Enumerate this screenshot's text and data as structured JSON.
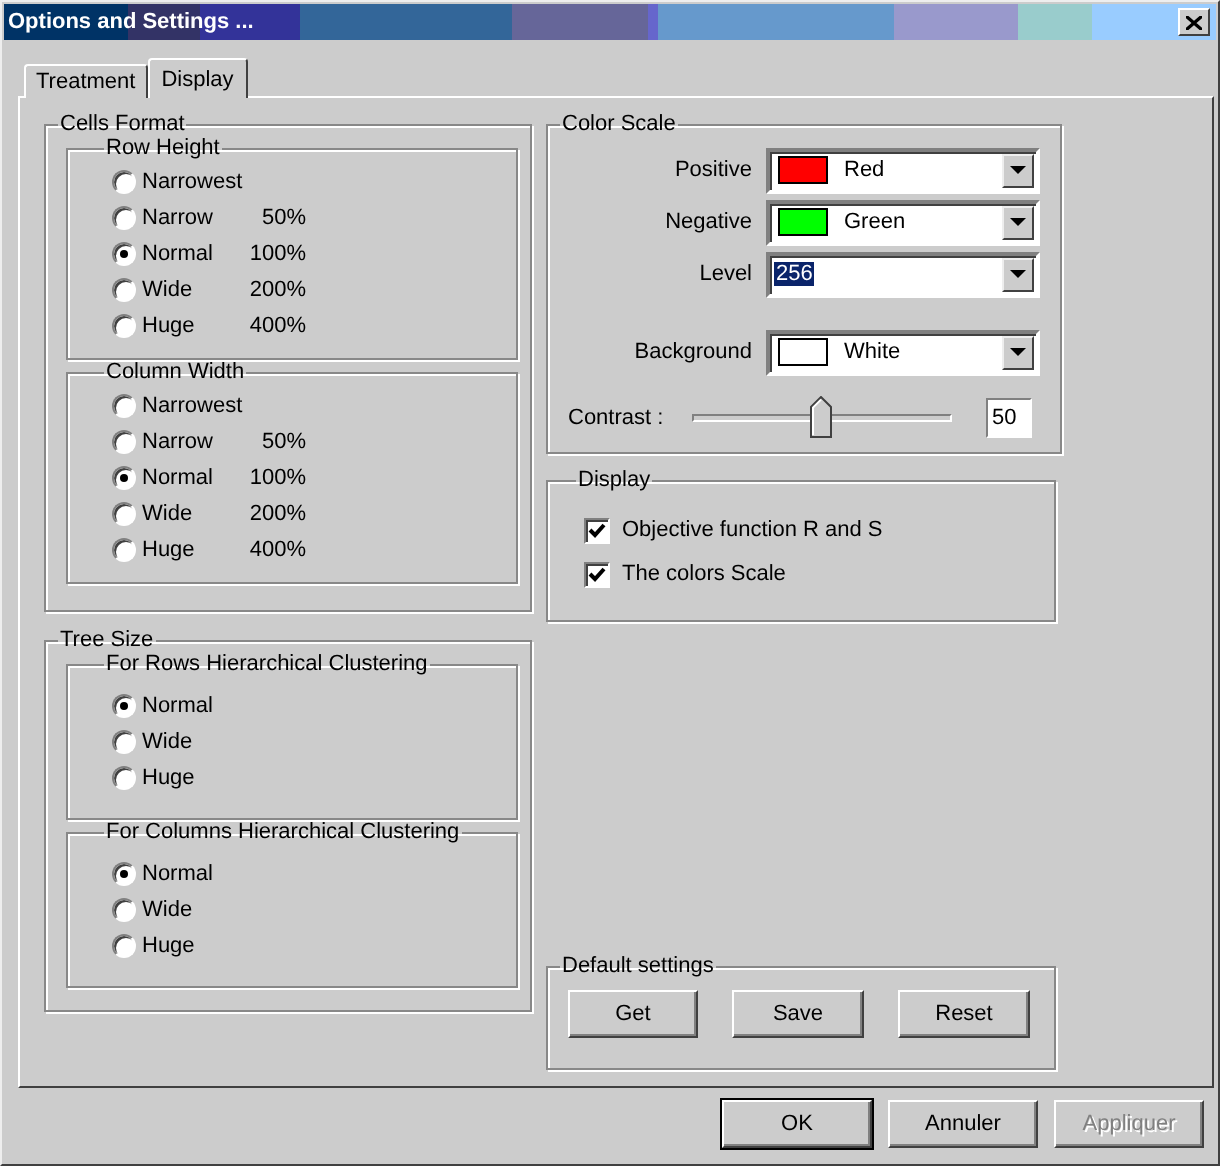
{
  "window": {
    "title": "Options and Settings ..."
  },
  "tabs": [
    {
      "label": "Treatment",
      "selected": false
    },
    {
      "label": "Display",
      "selected": true
    }
  ],
  "cells_format": {
    "title": "Cells Format",
    "groups": [
      {
        "title": "Row Height",
        "options": [
          {
            "label": "Narrowest",
            "selected": false
          },
          {
            "label": "Narrow",
            "value": "50%",
            "selected": false
          },
          {
            "label": "Normal",
            "value": "100%",
            "selected": true
          },
          {
            "label": "Wide",
            "value": "200%",
            "selected": false
          },
          {
            "label": "Huge",
            "value": "400%",
            "selected": false
          }
        ]
      },
      {
        "title": "Column Width",
        "options": [
          {
            "label": "Narrowest",
            "selected": false
          },
          {
            "label": "Narrow",
            "value": "50%",
            "selected": false
          },
          {
            "label": "Normal",
            "value": "100%",
            "selected": true
          },
          {
            "label": "Wide",
            "value": "200%",
            "selected": false
          },
          {
            "label": "Huge",
            "value": "400%",
            "selected": false
          }
        ]
      }
    ]
  },
  "tree_size": {
    "title": "Tree Size",
    "groups": [
      {
        "title": "For Rows Hierarchical Clustering",
        "options": [
          {
            "label": "Normal",
            "selected": true
          },
          {
            "label": "Wide",
            "selected": false
          },
          {
            "label": "Huge",
            "selected": false
          }
        ]
      },
      {
        "title": "For Columns Hierarchical Clustering",
        "options": [
          {
            "label": "Normal",
            "selected": true
          },
          {
            "label": "Wide",
            "selected": false
          },
          {
            "label": "Huge",
            "selected": false
          }
        ]
      }
    ]
  },
  "color_scale": {
    "title": "Color Scale",
    "rows": [
      {
        "label": "Positive",
        "value": "Red",
        "color": "#ff0000"
      },
      {
        "label": "Negative",
        "value": "Green",
        "color": "#00ff00"
      },
      {
        "label": "Level",
        "value": "256",
        "highlighted": true
      }
    ],
    "background": {
      "label": "Background",
      "value": "White",
      "color": "#ffffff"
    },
    "contrast": {
      "label": "Contrast :",
      "level": 0.5,
      "value": "50"
    }
  },
  "display": {
    "title": "Display",
    "options": [
      {
        "label": "Objective function R and S",
        "checked": true
      },
      {
        "label": "The colors Scale",
        "checked": true
      }
    ]
  },
  "default_settings": {
    "title": "Default settings",
    "buttons": [
      "Get",
      "Save",
      "Reset"
    ]
  },
  "buttons": [
    {
      "label": "OK",
      "default": true,
      "disabled": false
    },
    {
      "label": "Annuler",
      "default": false,
      "disabled": false
    },
    {
      "label": "Appliquer",
      "default": false,
      "disabled": true
    }
  ]
}
